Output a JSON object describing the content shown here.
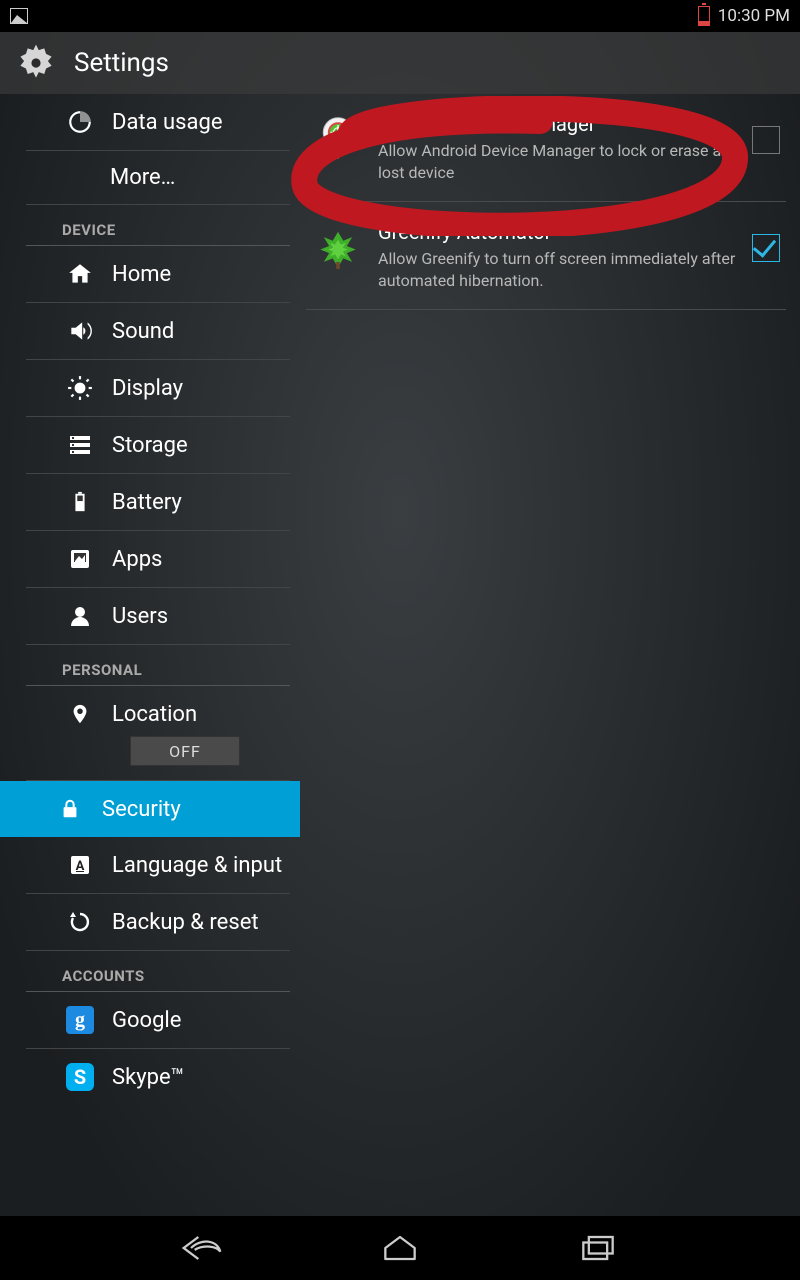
{
  "status": {
    "time": "10:30 PM"
  },
  "header": {
    "title": "Settings"
  },
  "sidebar": {
    "top": [
      {
        "label": "Data usage"
      },
      {
        "label": "More…"
      }
    ],
    "device_header": "DEVICE",
    "device": [
      {
        "label": "Home"
      },
      {
        "label": "Sound"
      },
      {
        "label": "Display"
      },
      {
        "label": "Storage"
      },
      {
        "label": "Battery"
      },
      {
        "label": "Apps"
      },
      {
        "label": "Users"
      }
    ],
    "personal_header": "PERSONAL",
    "personal": [
      {
        "label": "Location",
        "switch": "OFF"
      },
      {
        "label": "Security",
        "selected": true
      },
      {
        "label": "Language & input"
      },
      {
        "label": "Backup & reset"
      }
    ],
    "accounts_header": "ACCOUNTS",
    "accounts": [
      {
        "label": "Google"
      },
      {
        "label": "Skype™"
      }
    ]
  },
  "detail": {
    "items": [
      {
        "title": "Android Device Manager",
        "desc": "Allow Android Device Manager to lock or erase a lost device",
        "checked": false
      },
      {
        "title": "Greenify Automator",
        "desc": "Allow Greenify to turn off screen immediately after automated hibernation.",
        "checked": true
      }
    ]
  },
  "annotation": {
    "color": "#c01820"
  }
}
